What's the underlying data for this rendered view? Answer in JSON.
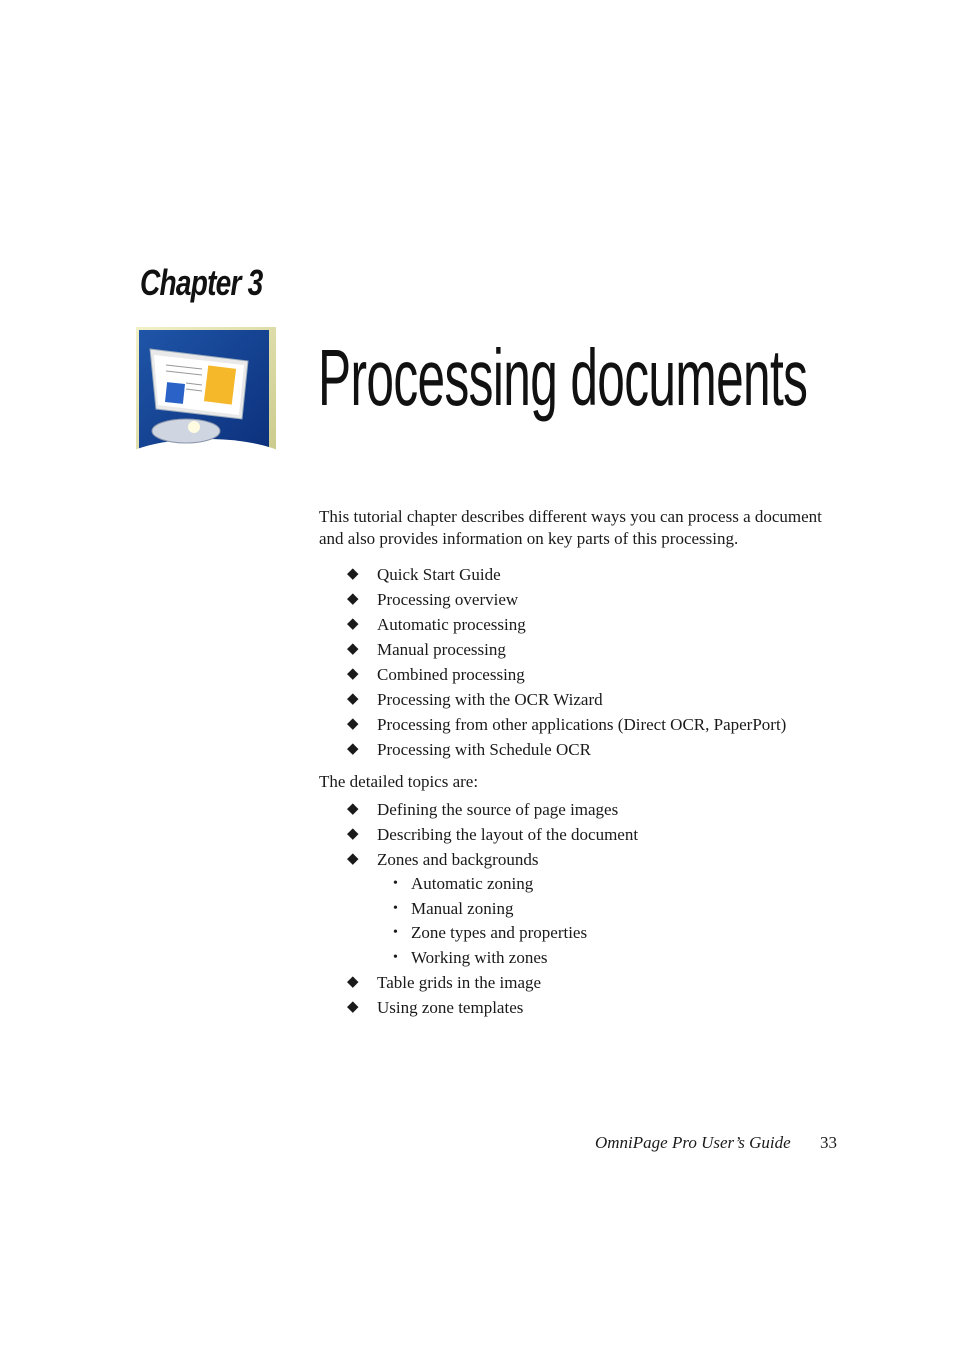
{
  "chapter": {
    "label": "Chapter 3",
    "title": "Processing documents",
    "image_alt": "scanner-with-document-illustration"
  },
  "intro": "This tutorial chapter describes different ways you can process a document and also provides information on key parts of this processing.",
  "main_topics": [
    "Quick Start Guide",
    "Processing overview",
    "Automatic processing",
    "Manual processing",
    "Combined processing",
    "Processing with the OCR Wizard",
    "Processing from other applications (Direct OCR, PaperPort)",
    "Processing with Schedule OCR"
  ],
  "detailed_lead": "The detailed topics are:",
  "detailed_topics": [
    {
      "label": "Defining the source of page images",
      "sub": []
    },
    {
      "label": "Describing the layout of the document",
      "sub": []
    },
    {
      "label": "Zones and backgrounds",
      "sub": [
        "Automatic zoning",
        "Manual zoning",
        "Zone types and properties",
        "Working with zones"
      ]
    },
    {
      "label": "Table grids in the image",
      "sub": []
    },
    {
      "label": "Using zone templates",
      "sub": []
    }
  ],
  "bullets": {
    "diamond": "◆",
    "dot": "•"
  },
  "footer": {
    "book_title": "OmniPage Pro User’s Guide",
    "page_number": "33"
  }
}
